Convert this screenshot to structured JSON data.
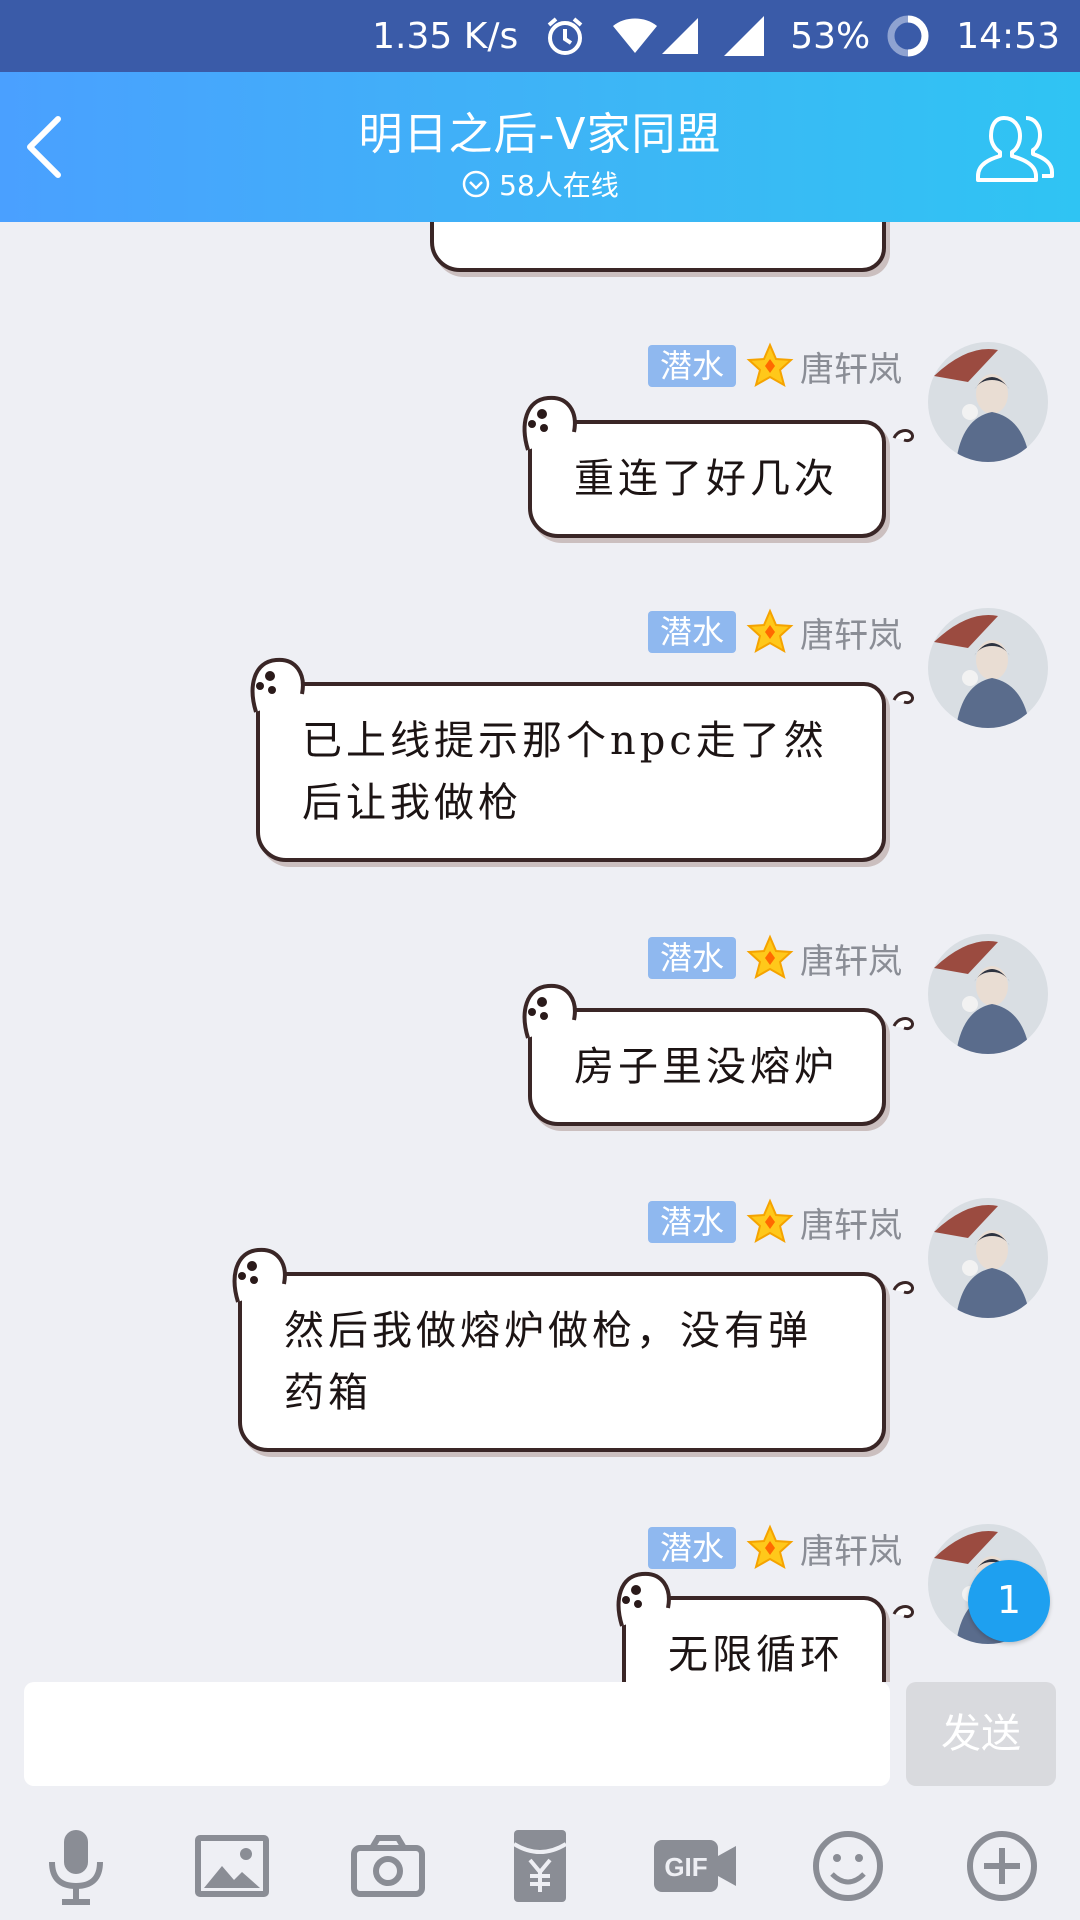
{
  "status_bar": {
    "speed": "1.35 K/s",
    "battery": "53%",
    "time": "14:53"
  },
  "header": {
    "title": "明日之后-V家同盟",
    "online": "58人在线"
  },
  "messages": [
    {
      "badge": "潜水",
      "name": "唐轩岚",
      "lines": [
        "重连了好几次"
      ]
    },
    {
      "badge": "潜水",
      "name": "唐轩岚",
      "lines": [
        "已上线提示那个npc走了然",
        "后让我做枪"
      ]
    },
    {
      "badge": "潜水",
      "name": "唐轩岚",
      "lines": [
        "房子里没熔炉"
      ]
    },
    {
      "badge": "潜水",
      "name": "唐轩岚",
      "lines": [
        "然后我做熔炉做枪，没有弹",
        "药箱"
      ]
    },
    {
      "badge": "潜水",
      "name": "唐轩岚",
      "lines": [
        "无限循环"
      ]
    }
  ],
  "unread_count": "1",
  "input": {
    "value": "",
    "send_label": "发送"
  },
  "toolbar": {
    "icons": [
      "microphone-icon",
      "image-icon",
      "camera-icon",
      "red-packet-icon",
      "gif-icon",
      "emoji-icon",
      "plus-icon"
    ]
  },
  "colors": {
    "status_bar": "#3a5ba8",
    "header_start": "#4aa0ff",
    "header_end": "#2fc4f3",
    "badge": "#8fb8ef",
    "unread": "#1ea0f0"
  }
}
